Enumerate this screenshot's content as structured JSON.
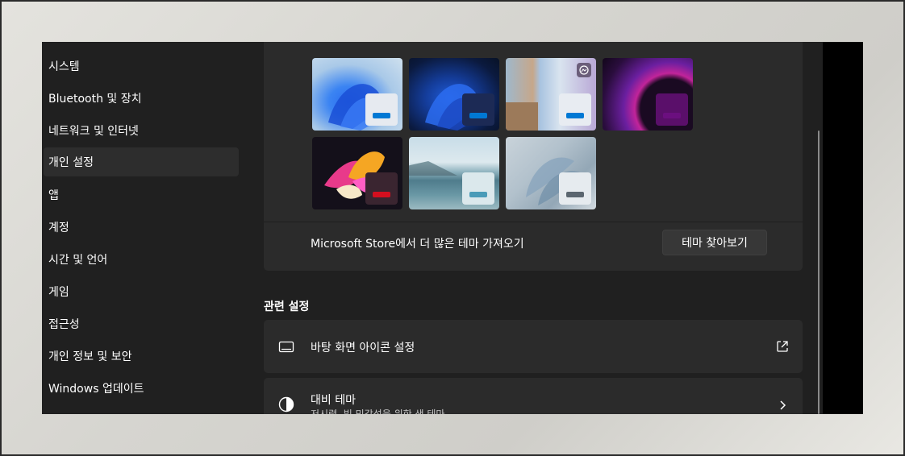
{
  "sidebar": {
    "items": [
      {
        "label": "시스템"
      },
      {
        "label": "Bluetooth 및 장치"
      },
      {
        "label": "네트워크 및 인터넷"
      },
      {
        "label": "개인 설정",
        "active": true
      },
      {
        "label": "앱"
      },
      {
        "label": "계정"
      },
      {
        "label": "시간 및 언어"
      },
      {
        "label": "게임"
      },
      {
        "label": "접근성"
      },
      {
        "label": "개인 정보 및 보안"
      },
      {
        "label": "Windows 업데이트"
      }
    ]
  },
  "themes": {
    "items": [
      {
        "name": "windows-light",
        "bar_color": "#0078d4"
      },
      {
        "name": "windows-dark",
        "bar_color": "#0078d4"
      },
      {
        "name": "windows-spotlight",
        "bar_color": "#0078d4"
      },
      {
        "name": "glow",
        "bar_color": "#6b0f7f"
      },
      {
        "name": "captured-motion",
        "bar_color": "#d40f1f"
      },
      {
        "name": "sunrise",
        "bar_color": "#4a9bb8"
      },
      {
        "name": "flow",
        "bar_color": "#5b6670"
      }
    ]
  },
  "store": {
    "label": "Microsoft Store에서 더 많은 테마 가져오기",
    "button_label": "테마 찾아보기"
  },
  "related": {
    "section_title": "관련 설정",
    "desktop_icons": {
      "title": "바탕 화면 아이콘 설정",
      "icon": "monitor-icon",
      "action_icon": "external-link-icon"
    },
    "contrast": {
      "title": "대비 테마",
      "subtitle": "저시력, 빛 민감성을 위한 색 테마",
      "icon": "contrast-icon",
      "action_icon": "chevron-right-icon"
    }
  },
  "colors": {
    "window_bg": "#202020",
    "card_bg": "#2b2b2b",
    "accent": "#0078d4"
  }
}
